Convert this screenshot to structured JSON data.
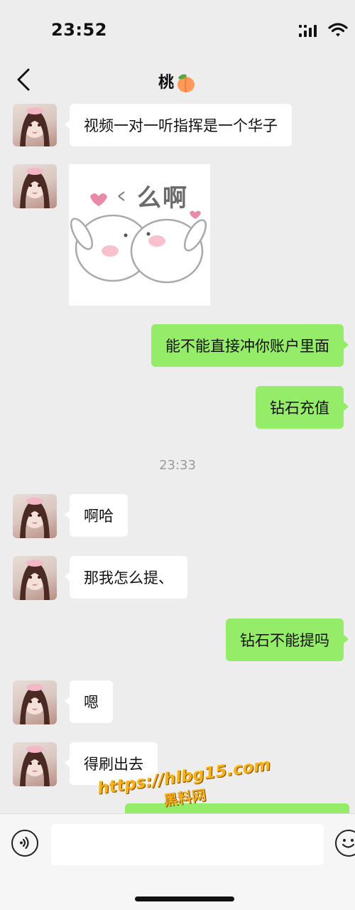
{
  "status_bar": {
    "time": "23:52"
  },
  "header": {
    "title": "桃",
    "title_emoji": "peach-emoji"
  },
  "messages": [
    {
      "side": "in",
      "type": "text",
      "text": "视频一对一听指挥是一个华子"
    },
    {
      "side": "in",
      "type": "sticker",
      "sticker_text": "么啊"
    },
    {
      "side": "out",
      "type": "text",
      "text": "能不能直接冲你账户里面"
    },
    {
      "side": "out",
      "type": "text",
      "text": "钻石充值"
    },
    {
      "type": "timestamp",
      "text": "23:33"
    },
    {
      "side": "in",
      "type": "text",
      "text": "啊哈"
    },
    {
      "side": "in",
      "type": "text",
      "text": "那我怎么提、"
    },
    {
      "side": "out",
      "type": "text",
      "text": "钻石不能提吗"
    },
    {
      "side": "in",
      "type": "text",
      "text": "嗯"
    },
    {
      "side": "in",
      "type": "text",
      "text": "得刷出去"
    }
  ],
  "watermark": {
    "url": "https://hlbg15.com",
    "name": "黑料网"
  },
  "input_bar": {
    "placeholder": ""
  },
  "colors": {
    "background": "#ededed",
    "outgoing_bubble": "#95ec69",
    "incoming_bubble": "#ffffff",
    "watermark": "#f5b21b"
  },
  "icons": [
    "back-icon",
    "signal-icon",
    "wifi-icon",
    "voice-icon",
    "emoji-icon"
  ]
}
